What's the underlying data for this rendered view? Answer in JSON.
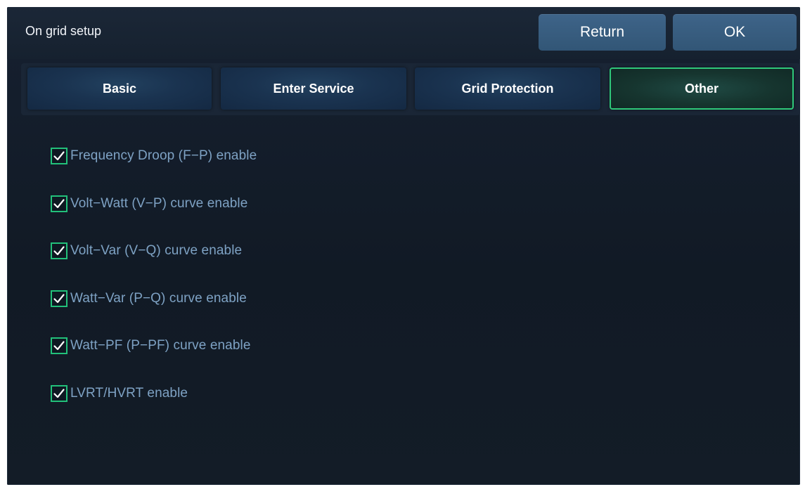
{
  "header": {
    "title": "On grid setup",
    "return_label": "Return",
    "ok_label": "OK"
  },
  "tabs": [
    {
      "label": "Basic",
      "active": false
    },
    {
      "label": "Enter Service",
      "active": false
    },
    {
      "label": "Grid Protection",
      "active": false
    },
    {
      "label": "Other",
      "active": true
    }
  ],
  "options": [
    {
      "label": "Frequency Droop (F−P) enable",
      "checked": true
    },
    {
      "label": "Volt−Watt (V−P) curve enable",
      "checked": true
    },
    {
      "label": "Volt−Var (V−Q) curve enable",
      "checked": true
    },
    {
      "label": "Watt−Var (P−Q) curve enable",
      "checked": true
    },
    {
      "label": "Watt−PF (P−PF) curve enable",
      "checked": true
    },
    {
      "label": "LVRT/HVRT enable",
      "checked": true
    }
  ],
  "colors": {
    "accent_green": "#22c07a",
    "button_blue": "#3a5f82",
    "label_blue": "#7ea2c4",
    "background": "#131c27"
  }
}
